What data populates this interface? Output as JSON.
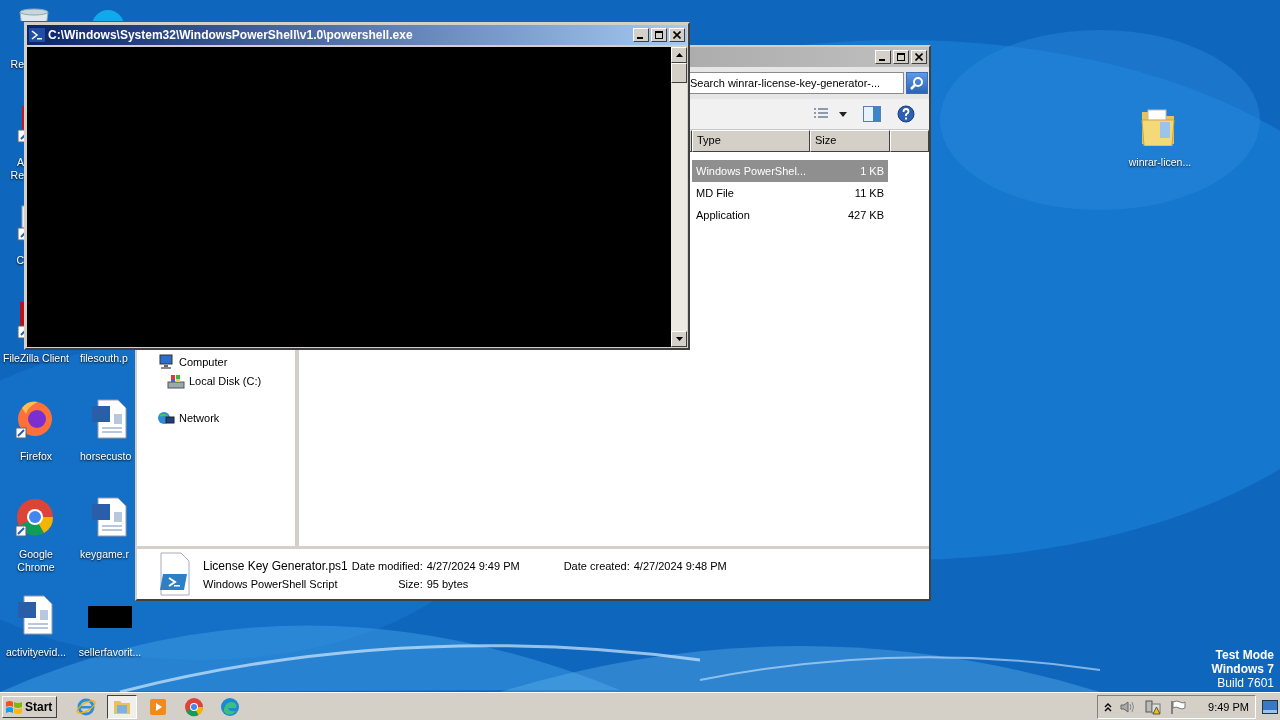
{
  "desktop": {
    "icons": [
      {
        "kind": "recycle-bin",
        "lines": [
          "Re"
        ]
      },
      {
        "kind": "pdf",
        "lines": [
          "A",
          "Re"
        ]
      },
      {
        "kind": "shortcut",
        "lines": [
          "C"
        ]
      },
      {
        "kind": "filezilla",
        "lines": [
          "FileZilla Client"
        ]
      },
      {
        "kind": "firefox",
        "lines": [
          "Firefox"
        ]
      },
      {
        "kind": "chrome",
        "lines": [
          "Google",
          "Chrome"
        ]
      },
      {
        "kind": "word",
        "lines": [
          "activityevid..."
        ]
      },
      {
        "kind": "chat"
      },
      {
        "lines": [
          "filesouth.p"
        ]
      },
      {
        "kind": "word",
        "lines": [
          "horsecusto"
        ]
      },
      {
        "kind": "word",
        "lines": [
          "keygame.r"
        ]
      },
      {
        "kind": "black",
        "lines": [
          "sellerfavorit..."
        ]
      },
      {
        "kind": "folder",
        "lines": [
          "winrar-licen..."
        ]
      }
    ],
    "system_watermark": [
      "Test Mode",
      "Windows 7",
      "Build 7601"
    ]
  },
  "explorer_window": {
    "search": {
      "placeholder": "Search winrar-license-key-generator-..."
    },
    "columns": [
      "Type",
      "Size"
    ],
    "files": [
      {
        "type": "Windows PowerShel...",
        "size": "1 KB",
        "selected": true
      },
      {
        "type": "MD File",
        "size": "11 KB",
        "selected": false
      },
      {
        "type": "Application",
        "size": "427 KB",
        "selected": false
      }
    ],
    "nav": [
      {
        "label": "Computer",
        "kind": "computer",
        "children": [
          {
            "label": "Local Disk (C:)",
            "kind": "disk"
          }
        ]
      },
      {
        "label": "Network",
        "kind": "network"
      }
    ],
    "details": {
      "name": "License Key Generator.ps1",
      "type": "Windows PowerShell Script",
      "fields": [
        {
          "label": "Date modified:",
          "value": "4/27/2024 9:49 PM"
        },
        {
          "label": "Size:",
          "value": "95 bytes"
        },
        {
          "label": "Date created:",
          "value": "4/27/2024 9:48 PM"
        }
      ]
    }
  },
  "powershell_window": {
    "title": "C:\\Windows\\System32\\WindowsPowerShell\\v1.0\\powershell.exe"
  },
  "taskbar": {
    "start": "Start",
    "apps": [
      {
        "kind": "ie",
        "selected": false
      },
      {
        "kind": "explorer",
        "selected": true
      },
      {
        "kind": "media",
        "selected": false
      },
      {
        "kind": "chrome",
        "selected": false
      },
      {
        "kind": "edge",
        "selected": false
      }
    ],
    "clock": "9:49 PM"
  }
}
